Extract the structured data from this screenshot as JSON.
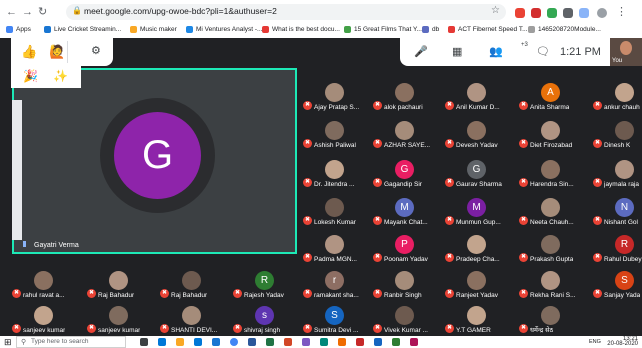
{
  "browser": {
    "url": "meet.google.com/upg-owoe-bdc?pli=1&authuser=2",
    "bookmarks": [
      "Apps",
      "Live Cricket Streamin...",
      "Music maker",
      "Mi Ventures Analyst -...",
      "What is the best docu...",
      "15 Great Films That Y...",
      "db",
      "ACT Fibernet Speed T...",
      "1465208720Module..."
    ],
    "colors": {
      "accent": "#1a73e8"
    }
  },
  "meet": {
    "clock": "1:21 PM",
    "participant_badge": "+3",
    "self_label": "You",
    "pinned": {
      "initial": "G",
      "name": "Gayatri Verma",
      "color": "#8e24aa",
      "border": "#1de9b6"
    },
    "participants": [
      {
        "name": "Ajay Pratap S...",
        "initial": "",
        "color": "#6a5acd"
      },
      {
        "name": "alok pachauri",
        "initial": "",
        "color": ""
      },
      {
        "name": "Anil Kumar D...",
        "initial": "",
        "color": ""
      },
      {
        "name": "Anita Sharma",
        "initial": "A",
        "color": "#e8710a"
      },
      {
        "name": "ankur chauh",
        "initial": "",
        "color": ""
      },
      {
        "name": "Ashish Paliwal",
        "initial": "",
        "color": ""
      },
      {
        "name": "AZHAR SAYE...",
        "initial": "",
        "color": ""
      },
      {
        "name": "Devesh Yadav",
        "initial": "",
        "color": ""
      },
      {
        "name": "Diet Firozabad",
        "initial": "",
        "color": ""
      },
      {
        "name": "Dinesh K",
        "initial": "",
        "color": ""
      },
      {
        "name": "Dr. Jitendra ...",
        "initial": "",
        "color": ""
      },
      {
        "name": "Gagandip Sir",
        "initial": "G",
        "color": "#e91e63"
      },
      {
        "name": "Gaurav Sharma",
        "initial": "G",
        "color": "#5f6368"
      },
      {
        "name": "Harendra Sin...",
        "initial": "",
        "color": ""
      },
      {
        "name": "jaymala raja",
        "initial": "",
        "color": ""
      },
      {
        "name": "Lokesh Kumar",
        "initial": "",
        "color": ""
      },
      {
        "name": "Mayank Chat...",
        "initial": "M",
        "color": "#5c6bc0"
      },
      {
        "name": "Munmun Gup...",
        "initial": "M",
        "color": "#7b1fa2"
      },
      {
        "name": "Neeta Chauh...",
        "initial": "",
        "color": ""
      },
      {
        "name": "Nishant Gol",
        "initial": "N",
        "color": "#5c6bc0"
      },
      {
        "name": "Padma MGN...",
        "initial": "",
        "color": ""
      },
      {
        "name": "Poonam Yadav",
        "initial": "P",
        "color": "#e91e63"
      },
      {
        "name": "Pradeep Cha...",
        "initial": "",
        "color": ""
      },
      {
        "name": "Prakash Gupta",
        "initial": "",
        "color": ""
      },
      {
        "name": "Rahul Dubey",
        "initial": "R",
        "color": "#c62828"
      },
      {
        "name": "rahul ravat a...",
        "initial": "",
        "color": ""
      },
      {
        "name": "Raj Bahadur",
        "initial": "",
        "color": ""
      },
      {
        "name": "Raj Bahadur",
        "initial": "",
        "color": ""
      },
      {
        "name": "Rajesh Yadav",
        "initial": "R",
        "color": "#2e7d32"
      },
      {
        "name": "ramakant sha...",
        "initial": "r",
        "color": "#8d6e63"
      },
      {
        "name": "Ranbir Singh",
        "initial": "",
        "color": ""
      },
      {
        "name": "Ranjeet Yadav",
        "initial": "",
        "color": ""
      },
      {
        "name": "Rekha Rani S...",
        "initial": "",
        "color": ""
      },
      {
        "name": "Sanjay Yada",
        "initial": "S",
        "color": "#d84315"
      },
      {
        "name": "sanjeev kumar",
        "initial": "",
        "color": ""
      },
      {
        "name": "sanjeev kumar",
        "initial": "",
        "color": ""
      },
      {
        "name": "SHANTI DEVI...",
        "initial": "",
        "color": ""
      },
      {
        "name": "shivraj singh",
        "initial": "s",
        "color": "#5e35b1"
      },
      {
        "name": "Sumitra Devi ...",
        "initial": "S",
        "color": "#1565c0"
      },
      {
        "name": "Vivek Kumar ...",
        "initial": "",
        "color": ""
      },
      {
        "name": "Y.T GAMER",
        "initial": "",
        "color": ""
      },
      {
        "name": "धर्मेन्द्र सेठ",
        "initial": "",
        "color": ""
      }
    ]
  },
  "taskbar": {
    "search_placeholder": "Type here to search",
    "lang": "ENG",
    "time": "13:21",
    "date": "20-08-2020"
  }
}
